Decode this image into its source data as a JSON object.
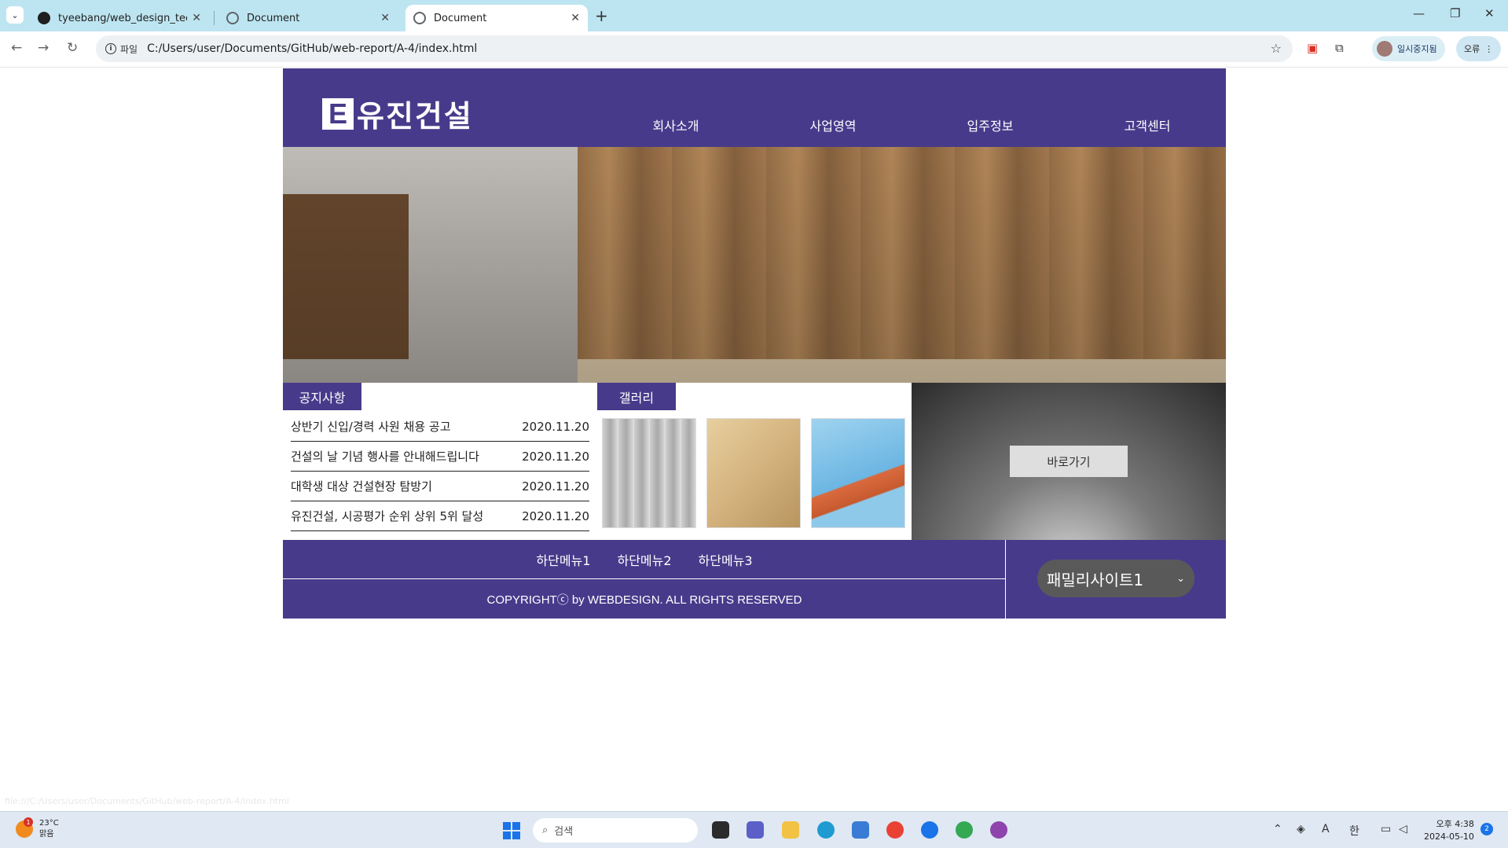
{
  "browser": {
    "tabs": [
      {
        "title": "tyeebang/web_design_technic"
      },
      {
        "title": "Document"
      },
      {
        "title": "Document"
      }
    ],
    "omnibox": {
      "scheme_label": "파일",
      "url": "C:/Users/user/Documents/GitHub/web-report/A-4/index.html"
    },
    "profile_label": "일시중지됨",
    "error_label": "오류"
  },
  "site": {
    "logo_mark": "E",
    "logo_text": "유진건설",
    "nav": [
      "회사소개",
      "사업영역",
      "입주정보",
      "고객센터"
    ],
    "notice": {
      "title": "공지사항",
      "items": [
        {
          "text": "상반기 신입/경력 사원 채용 공고",
          "date": "2020.11.20"
        },
        {
          "text": "건설의 날 기념 행사를 안내해드립니다",
          "date": "2020.11.20"
        },
        {
          "text": "대학생 대상 건설현장 탐방기",
          "date": "2020.11.20"
        },
        {
          "text": "유진건설, 시공평가 순위 상위 5위 달성",
          "date": "2020.11.20"
        }
      ]
    },
    "gallery": {
      "title": "갤러리"
    },
    "shortcut_label": "바로가기",
    "footer": {
      "menu": [
        "하단메뉴1",
        "하단메뉴2",
        "하단메뉴3"
      ],
      "copyright": "COPYRIGHTⓒ by WEBDESIGN. ALL RIGHTS RESERVED",
      "family_site": "패밀리사이트1"
    },
    "colors": {
      "primary": "#483a8b"
    }
  },
  "status_bar_url": "file:///C:/Users/user/Documents/GitHub/web-report/A-4/index.html",
  "taskbar": {
    "weather_temp": "23°C",
    "weather_desc": "맑음",
    "weather_badge": "1",
    "search_placeholder": "검색",
    "clock_time": "오후 4:38",
    "clock_date": "2024-05-10",
    "notification_count": "2",
    "ime": "한"
  }
}
